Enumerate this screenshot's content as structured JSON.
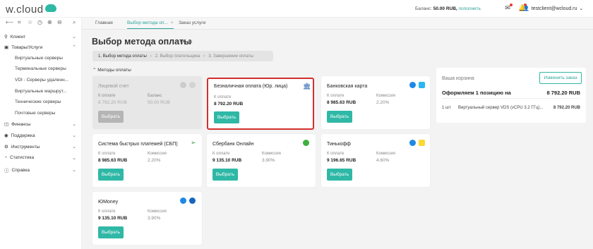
{
  "app": {
    "logo": "w.cloud"
  },
  "topbar": {
    "balance_label": "Баланс:",
    "balance_value": "50.00 RUB,",
    "topup_link": "пополнить",
    "user_email": "testclient@wcloud.ru"
  },
  "tabs": [
    {
      "label": "Главная"
    },
    {
      "label": "Выбор метода оп..."
    },
    {
      "label": "Заказ услуги"
    }
  ],
  "tab_close": "×",
  "sidebar": {
    "groups": [
      {
        "label": "Клиент"
      },
      {
        "label": "Товары/Услуги"
      },
      {
        "label": "Финансы"
      },
      {
        "label": "Поддержка"
      },
      {
        "label": "Инструменты"
      },
      {
        "label": "Статистика"
      },
      {
        "label": "Справка"
      }
    ],
    "sub_items": [
      {
        "label": "Виртуальные серверы"
      },
      {
        "label": "Терминальные серверы"
      },
      {
        "label": "VDI - Серверы удаленн..."
      },
      {
        "label": "Виртуальные маршрут..."
      },
      {
        "label": "Технические серверы"
      },
      {
        "label": "Почтовые серверы"
      }
    ]
  },
  "page": {
    "title": "Выбор метода оплаты",
    "steps": [
      "1. Выбор метода оплаты",
      "2. Выбор плательщика",
      "3. Завершение оплаты"
    ],
    "step_sep": "›",
    "section": "Методы оплаты"
  },
  "cards": [
    {
      "name": "Лицевой счет",
      "amount_label": "К оплате",
      "amount": "8 792.20 RUB",
      "side_label": "Баланс",
      "side_value": "50.00 RUB",
      "button": "Выбрать"
    },
    {
      "name": "Безналичная оплата (Юр. лица)",
      "amount_label": "К оплате",
      "amount": "8 792.20 RUB",
      "button": "Выбрать"
    },
    {
      "name": "Банковская карта",
      "amount_label": "К оплате",
      "amount": "8 985.63 RUB",
      "side_label": "Комиссия",
      "side_value": "2.20%",
      "button": "Выбрать"
    },
    {
      "name": "Система быстрых платежей (СБП)",
      "amount_label": "К оплате",
      "amount": "8 985.63 RUB",
      "side_label": "Комиссия",
      "side_value": "2.20%",
      "button": "Выбрать"
    },
    {
      "name": "Сбербанк Онлайн",
      "amount_label": "К оплате",
      "amount": "9 135.10 RUB",
      "side_label": "Комиссия",
      "side_value": "3.90%",
      "button": "Выбрать"
    },
    {
      "name": "Тинькофф",
      "amount_label": "К оплате",
      "amount": "9 196.65 RUB",
      "side_label": "Комиссия",
      "side_value": "4.60%",
      "button": "Выбрать"
    },
    {
      "name": "ЮMoney",
      "amount_label": "К оплате",
      "amount": "9 135.10 RUB",
      "side_label": "Комиссия",
      "side_value": "3.90%",
      "button": "Выбрать"
    }
  ],
  "cart": {
    "title": "Ваша корзина",
    "change_button": "Изменить заказ",
    "heading": "Оформляем 1 позицию на",
    "total": "8 792.20 RUB",
    "item_qty": "1 шт",
    "item_name": "Виртуальный сервер VDS (vCPU 3.2 ГГц)...",
    "item_price": "8 792.20 RUB"
  },
  "colors": {
    "accent": "#2fb8a6",
    "selected_border": "#d32f2f",
    "danger": "#e53935"
  }
}
